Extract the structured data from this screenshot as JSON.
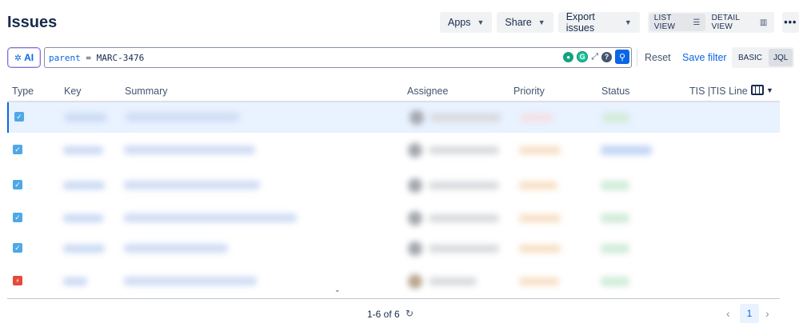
{
  "page": {
    "title": "Issues"
  },
  "toolbar": {
    "apps_label": "Apps",
    "share_label": "Share",
    "export_label": "Export issues",
    "list_view_label": "LIST VIEW",
    "detail_view_label": "DETAIL VIEW",
    "more_label": "•••"
  },
  "search": {
    "ai_label": "AI",
    "jql_keyword": "parent",
    "jql_rest": " = MARC-3476",
    "reset_label": "Reset",
    "save_filter_label": "Save filter",
    "basic_label": "BASIC",
    "jql_label": "JQL",
    "help_glyph": "?"
  },
  "table": {
    "columns": [
      "Type",
      "Key",
      "Summary",
      "Assignee",
      "Priority",
      "Status",
      "TIS |TIS Line I"
    ],
    "rows": [
      {
        "type": "task",
        "selected": true
      },
      {
        "type": "task",
        "selected": false
      },
      {
        "type": "task",
        "selected": false
      },
      {
        "type": "task",
        "selected": false
      },
      {
        "type": "task",
        "selected": false
      },
      {
        "type": "bug",
        "selected": false
      }
    ]
  },
  "footer": {
    "count_text": "1-6 of 6",
    "current_page": "1"
  },
  "colors": {
    "accent": "#0c66e4",
    "task_icon": "#4fa7e8",
    "bug_icon": "#e5493a",
    "selected_row": "#e9f2ff"
  }
}
